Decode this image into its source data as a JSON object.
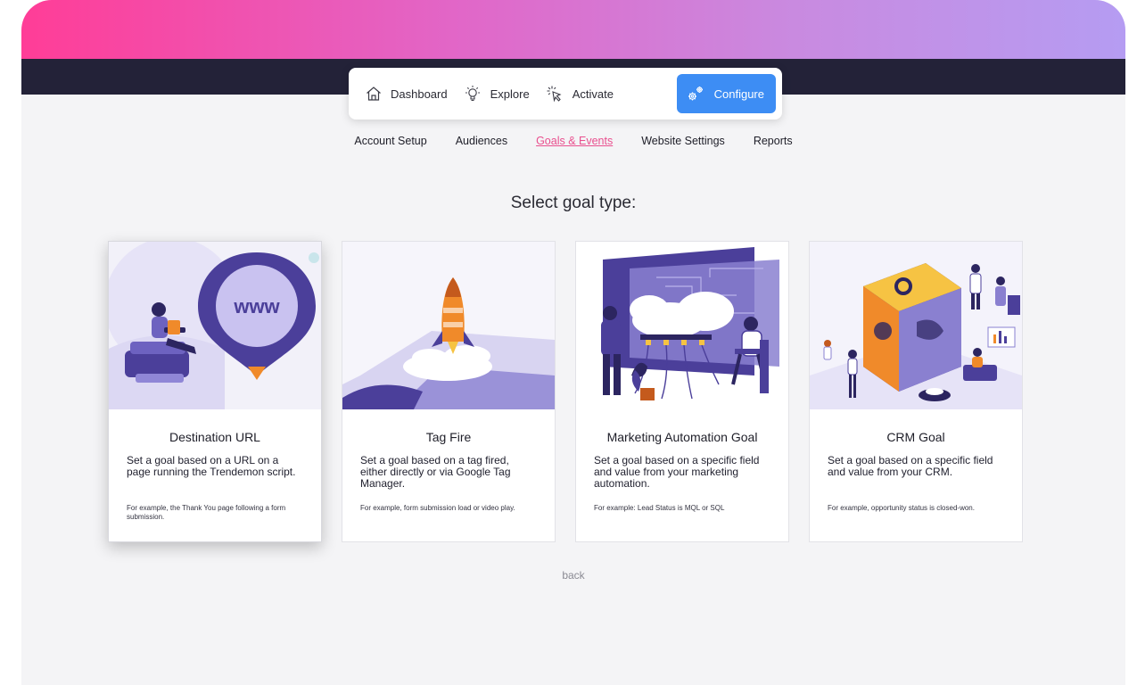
{
  "nav": {
    "items": [
      {
        "label": "Dashboard",
        "icon": "home-icon"
      },
      {
        "label": "Explore",
        "icon": "lightbulb-icon"
      },
      {
        "label": "Activate",
        "icon": "click-cursor-icon"
      },
      {
        "label": "Configure",
        "icon": "gears-icon"
      }
    ],
    "active": "Configure",
    "active_color": "#3d8df4"
  },
  "subnav": {
    "items": [
      "Account Setup",
      "Audiences",
      "Goals & Events",
      "Website Settings",
      "Reports"
    ],
    "active": "Goals & Events",
    "active_color": "#e94f8e"
  },
  "heading": "Select goal type:",
  "cards": [
    {
      "title": "Destination URL",
      "description": "Set a goal based on a URL on a page running the Trendemon script.",
      "example": "For example, the Thank You page following a form submission.",
      "illustration_text": "www"
    },
    {
      "title": "Tag Fire",
      "description": "Set a goal based on a tag fired, either directly or via Google Tag Manager.",
      "example": "For example, form submission load or video play."
    },
    {
      "title": "Marketing Automation Goal",
      "description": "Set a goal based on a specific field and value from your marketing automation.",
      "example": "For example: Lead Status is MQL or SQL"
    },
    {
      "title": "CRM Goal",
      "description": "Set a goal based on a specific field and value from your CRM.",
      "example": "For example, opportunity status is closed-won."
    }
  ],
  "back_label": "back",
  "colors": {
    "gradient_start": "#ff3d97",
    "gradient_end": "#b59cf2",
    "dark_band": "#232238",
    "illustration_purple": "#4b3f9a"
  }
}
